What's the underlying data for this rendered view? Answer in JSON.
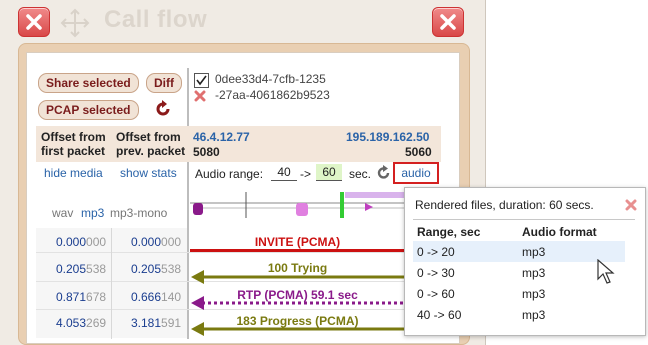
{
  "window": {
    "title": "Call flow"
  },
  "toolbar": {
    "share_selected": "Share selected",
    "diff": "Diff",
    "pcap_selected": "PCAP selected"
  },
  "call": {
    "id_line1": "0dee33d4-7cfb-1235",
    "id_line2": "-27aa-4061862b9523",
    "checked": true
  },
  "columns": {
    "offset_first": [
      "Offset from",
      "first packet"
    ],
    "offset_prev": [
      "Offset from",
      "prev. packet"
    ]
  },
  "endpoints": {
    "left_ip": "46.4.12.77",
    "left_port": "5080",
    "right_ip": "195.189.162.50",
    "right_port": "5060"
  },
  "links": {
    "hide_media": "hide media",
    "show_stats": "show stats"
  },
  "audio_range": {
    "label": "Audio range:",
    "from": "40",
    "arrow": "->",
    "to": "60",
    "unit": "sec.",
    "audio_button": "audio"
  },
  "formats": {
    "wav": "wav",
    "mp3": "mp3",
    "mp3_mono": "mp3-mono"
  },
  "rows": [
    {
      "off_first_main": "0.000",
      "off_first_dim": "000",
      "off_prev_main": "0.000",
      "off_prev_dim": "000",
      "label": "INVITE (PCMA)",
      "color": "#cc1111"
    },
    {
      "off_first_main": "0.205",
      "off_first_dim": "538",
      "off_prev_main": "0.205",
      "off_prev_dim": "538",
      "label": "100 Trying",
      "color": "#7a7a10"
    },
    {
      "off_first_main": "0.871",
      "off_first_dim": "678",
      "off_prev_main": "0.666",
      "off_prev_dim": "140",
      "label": "RTP (PCMA) 59.1 sec",
      "color": "#8a1a8a"
    },
    {
      "off_first_main": "4.053",
      "off_first_dim": "269",
      "off_prev_main": "3.181",
      "off_prev_dim": "591",
      "label": "183 Progress (PCMA)",
      "color": "#7a7a10"
    }
  ],
  "popup": {
    "header": "Rendered files, duration: 60 secs.",
    "col_range": "Range, sec",
    "col_format": "Audio format",
    "items": [
      {
        "range": "0 -> 20",
        "format": "mp3"
      },
      {
        "range": "0 -> 30",
        "format": "mp3"
      },
      {
        "range": "0 -> 60",
        "format": "mp3"
      },
      {
        "range": "40 -> 60",
        "format": "mp3"
      }
    ]
  }
}
